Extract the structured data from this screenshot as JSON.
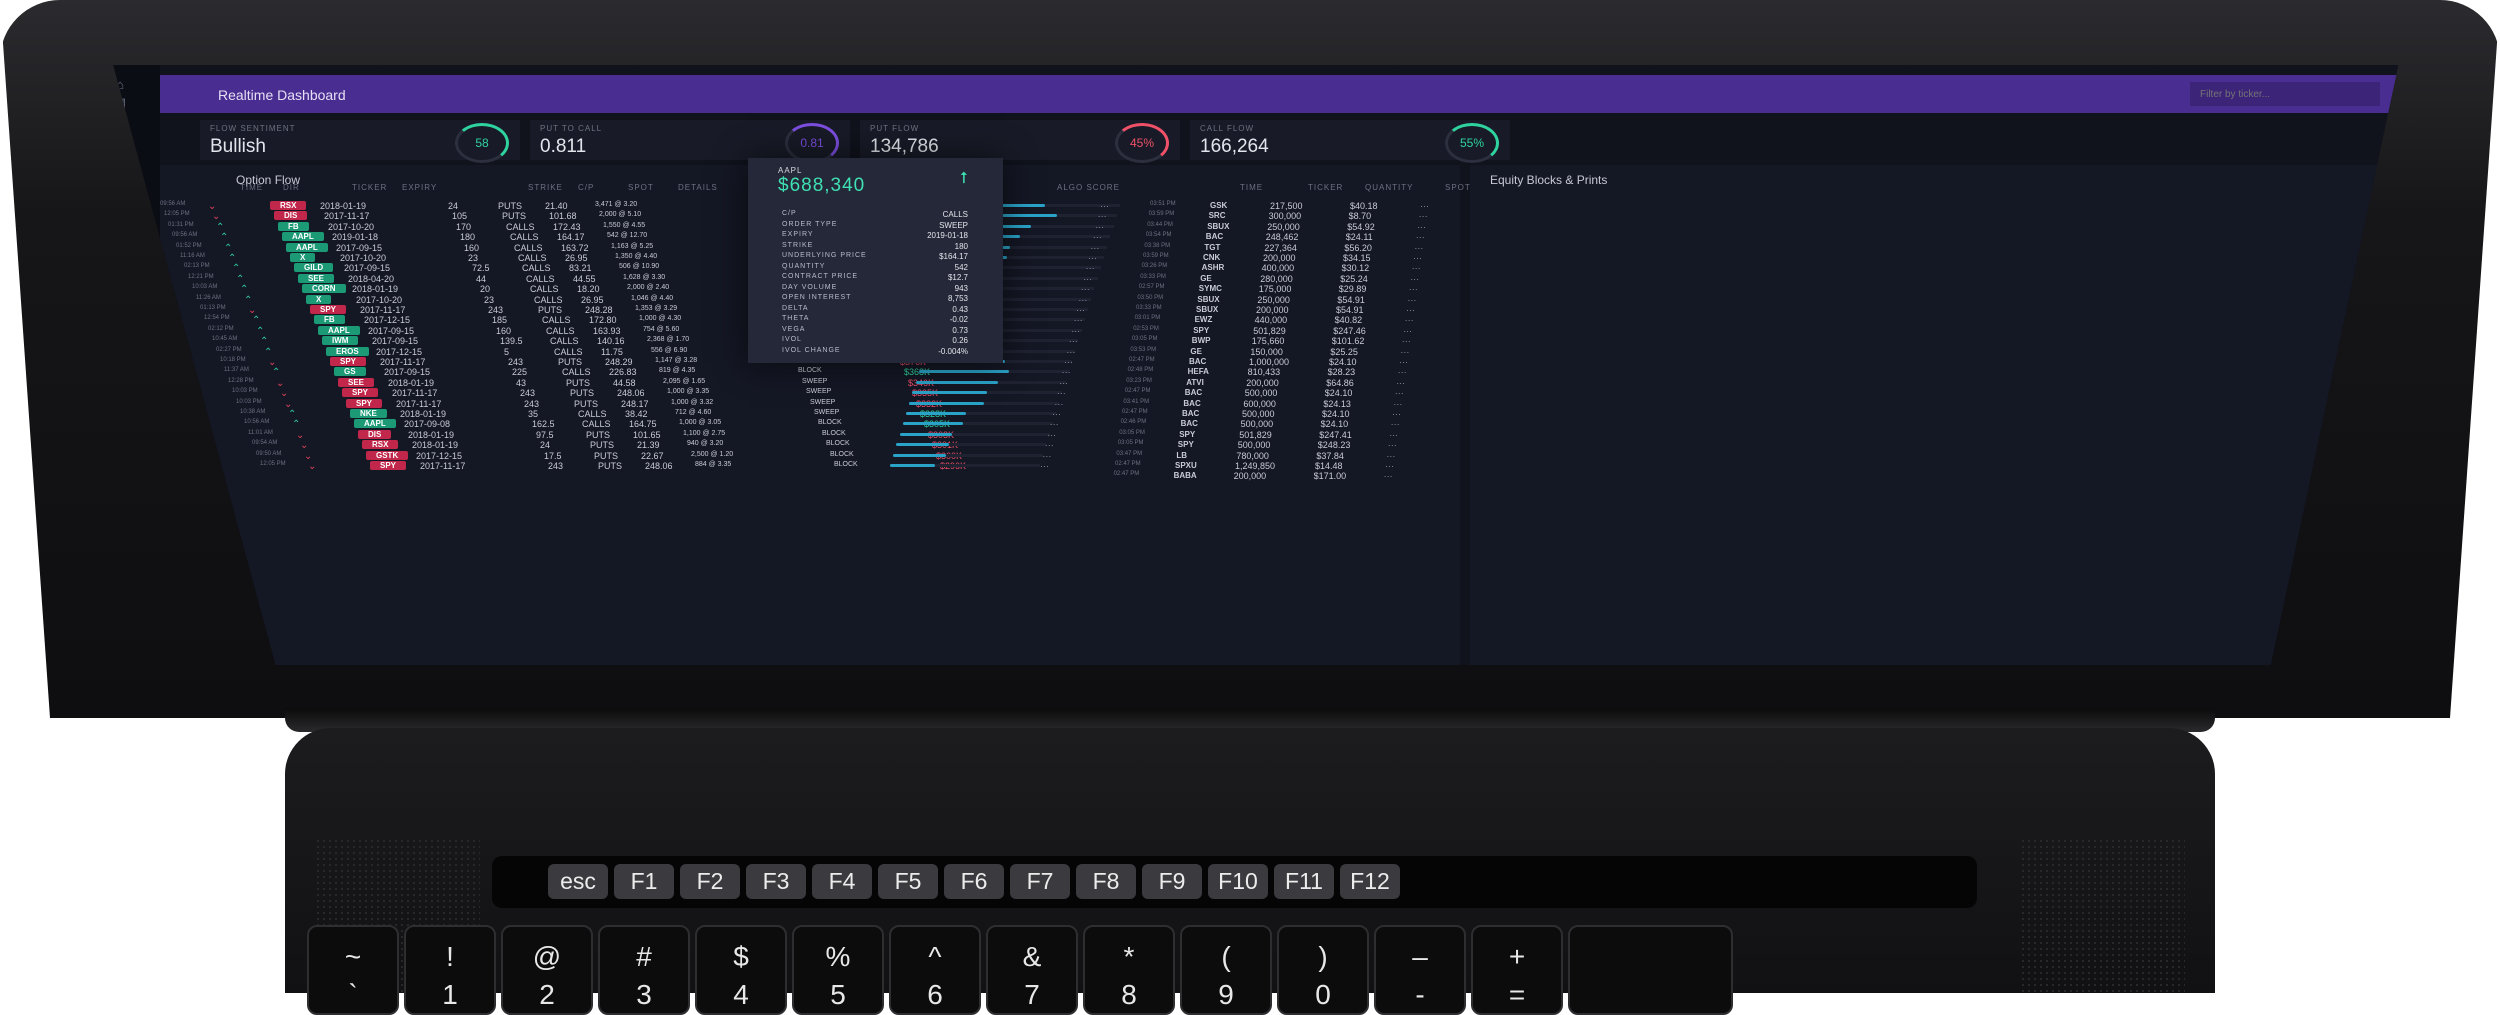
{
  "app": {
    "title": "Realtime Dashboard",
    "filter_placeholder": "Filter by ticker..."
  },
  "stats": [
    {
      "label": "Flow Sentiment",
      "value": "Bullish",
      "gauge": "58",
      "color": "#2fd39f"
    },
    {
      "label": "Put to Call",
      "value": "0.811",
      "gauge": "0.81",
      "color": "#7c4ee0"
    },
    {
      "label": "Put Flow",
      "value": "134,786",
      "gauge": "45%",
      "color": "#ef5169"
    },
    {
      "label": "Call Flow",
      "value": "166,264",
      "gauge": "55%",
      "color": "#2fd39f"
    }
  ],
  "option_flow": {
    "title": "Option Flow",
    "headers": {
      "time": "TIME",
      "dir": "DIR",
      "ticker": "TICKER",
      "expiry": "EXPIRY",
      "strike": "STRIKE",
      "cp": "C/P",
      "spot": "SPOT",
      "details": "DETAILS",
      "algo": "ALGO SCORE"
    },
    "rows": [
      {
        "time": "09:56 AM",
        "dir": "down",
        "ticker": "RSX",
        "tcolor": "red",
        "expiry": "2018-01-19",
        "strike": "24",
        "cp": "PUTS",
        "spot": "21.40",
        "details": "3,471 @ 3.20",
        "type": "",
        "premium": "",
        "pcolor": "green",
        "algo": 0.5
      },
      {
        "time": "12:05 PM",
        "dir": "down",
        "ticker": "DIS",
        "tcolor": "red",
        "expiry": "2017-11-17",
        "strike": "105",
        "cp": "PUTS",
        "spot": "101.68",
        "details": "2,000 @ 5.10",
        "type": "",
        "premium": "",
        "pcolor": "green",
        "algo": 0.6
      },
      {
        "time": "01:31 PM",
        "dir": "up",
        "ticker": "FB",
        "tcolor": "green",
        "expiry": "2017-10-20",
        "strike": "170",
        "cp": "CALLS",
        "spot": "172.43",
        "details": "1,550 @ 4.55",
        "type": "",
        "premium": "",
        "pcolor": "green",
        "algo": 0.45
      },
      {
        "time": "09:56 AM",
        "dir": "up",
        "ticker": "AAPL",
        "tcolor": "green",
        "expiry": "2019-01-18",
        "strike": "180",
        "cp": "CALLS",
        "spot": "164.17",
        "details": "542 @ 12.70",
        "type": "",
        "premium": "",
        "pcolor": "green",
        "algo": 0.4
      },
      {
        "time": "01:52 PM",
        "dir": "up",
        "ticker": "AAPL",
        "tcolor": "green",
        "expiry": "2017-09-15",
        "strike": "160",
        "cp": "CALLS",
        "spot": "163.72",
        "details": "1,163 @ 5.25",
        "type": "",
        "premium": "",
        "pcolor": "green",
        "algo": 0.35
      },
      {
        "time": "11:16 AM",
        "dir": "up",
        "ticker": "X",
        "tcolor": "green",
        "expiry": "2017-10-20",
        "strike": "23",
        "cp": "CALLS",
        "spot": "26.95",
        "details": "1,350 @ 4.40",
        "type": "",
        "premium": "",
        "pcolor": "green",
        "algo": 0.35
      },
      {
        "time": "02:13 PM",
        "dir": "up",
        "ticker": "GILD",
        "tcolor": "green",
        "expiry": "2017-09-15",
        "strike": "72.5",
        "cp": "CALLS",
        "spot": "83.21",
        "details": "506 @ 10.90",
        "type": "",
        "premium": "",
        "pcolor": "green",
        "algo": 0.3
      },
      {
        "time": "12:21 PM",
        "dir": "up",
        "ticker": "SEE",
        "tcolor": "green",
        "expiry": "2018-04-20",
        "strike": "44",
        "cp": "CALLS",
        "spot": "44.55",
        "details": "1,628 @ 3.30",
        "type": "",
        "premium": "",
        "pcolor": "green",
        "algo": 0.3
      },
      {
        "time": "10:03 AM",
        "dir": "up",
        "ticker": "CORN",
        "tcolor": "green",
        "expiry": "2018-01-19",
        "strike": "20",
        "cp": "CALLS",
        "spot": "18.20",
        "details": "2,000 @ 2.40",
        "type": "",
        "premium": "",
        "pcolor": "green",
        "algo": 0.25
      },
      {
        "time": "11:26 AM",
        "dir": "up",
        "ticker": "X",
        "tcolor": "green",
        "expiry": "2017-10-20",
        "strike": "23",
        "cp": "CALLS",
        "spot": "26.95",
        "details": "1,046 @ 4.40",
        "type": "",
        "premium": "",
        "pcolor": "green",
        "algo": 0.25
      },
      {
        "time": "01:13 PM",
        "dir": "down",
        "ticker": "SPY",
        "tcolor": "red",
        "expiry": "2017-11-17",
        "strike": "243",
        "cp": "PUTS",
        "spot": "248.28",
        "details": "1,353 @ 3.29",
        "type": "",
        "premium": "",
        "pcolor": "green",
        "algo": 0.2
      },
      {
        "time": "12:54 PM",
        "dir": "up",
        "ticker": "FB",
        "tcolor": "green",
        "expiry": "2017-12-15",
        "strike": "185",
        "cp": "CALLS",
        "spot": "172.80",
        "details": "1,000 @ 4.30",
        "type": "",
        "premium": "",
        "pcolor": "green",
        "algo": 0.25
      },
      {
        "time": "02:12 PM",
        "dir": "up",
        "ticker": "AAPL",
        "tcolor": "green",
        "expiry": "2017-09-15",
        "strike": "160",
        "cp": "CALLS",
        "spot": "163.93",
        "details": "754 @ 5.60",
        "type": "",
        "premium": "",
        "pcolor": "green",
        "algo": 0.3
      },
      {
        "time": "10:45 AM",
        "dir": "up",
        "ticker": "IWM",
        "tcolor": "green",
        "expiry": "2017-09-15",
        "strike": "139.5",
        "cp": "CALLS",
        "spot": "140.16",
        "details": "2,368 @ 1.70",
        "type": "",
        "premium": "",
        "pcolor": "green",
        "algo": 0.4
      },
      {
        "time": "02:27 PM",
        "dir": "up",
        "ticker": "EROS",
        "tcolor": "green",
        "expiry": "2017-12-15",
        "strike": "5",
        "cp": "CALLS",
        "spot": "11.75",
        "details": "556 @ 6.90",
        "type": "SWEEP",
        "premium": "$384K",
        "pcolor": "green",
        "algo": 0.45
      },
      {
        "time": "10:18 PM",
        "dir": "down",
        "ticker": "SPY",
        "tcolor": "red",
        "expiry": "2017-11-17",
        "strike": "243",
        "cp": "PUTS",
        "spot": "248.29",
        "details": "1,147 @ 3.28",
        "type": "SWEEP",
        "premium": "$376K",
        "pcolor": "red",
        "algo": 0.55
      },
      {
        "time": "11:37 AM",
        "dir": "up",
        "ticker": "GS",
        "tcolor": "green",
        "expiry": "2017-09-15",
        "strike": "225",
        "cp": "CALLS",
        "spot": "226.83",
        "details": "819 @ 4.35",
        "type": "BLOCK",
        "premium": "$368K",
        "pcolor": "green",
        "algo": 0.6
      },
      {
        "time": "12:28 PM",
        "dir": "down",
        "ticker": "SEE",
        "tcolor": "red",
        "expiry": "2018-01-19",
        "strike": "43",
        "cp": "PUTS",
        "spot": "44.58",
        "details": "2,095 @ 1.65",
        "type": "SWEEP",
        "premium": "$346K",
        "pcolor": "red",
        "algo": 0.55
      },
      {
        "time": "10:03 PM",
        "dir": "down",
        "ticker": "SPY",
        "tcolor": "red",
        "expiry": "2017-11-17",
        "strike": "243",
        "cp": "PUTS",
        "spot": "248.06",
        "details": "1,000 @ 3.35",
        "type": "SWEEP",
        "premium": "$335K",
        "pcolor": "red",
        "algo": 0.5
      },
      {
        "time": "10:03 PM",
        "dir": "down",
        "ticker": "SPY",
        "tcolor": "red",
        "expiry": "2017-11-17",
        "strike": "243",
        "cp": "PUTS",
        "spot": "248.17",
        "details": "1,000 @ 3.32",
        "type": "SWEEP",
        "premium": "$332K",
        "pcolor": "red",
        "algo": 0.5
      },
      {
        "time": "10:38 AM",
        "dir": "up",
        "ticker": "NKE",
        "tcolor": "green",
        "expiry": "2018-01-19",
        "strike": "35",
        "cp": "CALLS",
        "spot": "38.42",
        "details": "712 @ 4.60",
        "type": "SWEEP",
        "premium": "$328K",
        "pcolor": "green",
        "algo": 0.4
      },
      {
        "time": "10:56 AM",
        "dir": "up",
        "ticker": "AAPL",
        "tcolor": "green",
        "expiry": "2017-09-08",
        "strike": "162.5",
        "cp": "CALLS",
        "spot": "164.75",
        "details": "1,000 @ 3.05",
        "type": "BLOCK",
        "premium": "$305K",
        "pcolor": "green",
        "algo": 0.4
      },
      {
        "time": "11:01 AM",
        "dir": "down",
        "ticker": "DIS",
        "tcolor": "red",
        "expiry": "2018-01-19",
        "strike": "97.5",
        "cp": "PUTS",
        "spot": "101.65",
        "details": "1,100 @ 2.75",
        "type": "BLOCK",
        "premium": "$303K",
        "pcolor": "red",
        "algo": 0.35
      },
      {
        "time": "09:54 AM",
        "dir": "down",
        "ticker": "RSX",
        "tcolor": "red",
        "expiry": "2018-01-19",
        "strike": "24",
        "cp": "PUTS",
        "spot": "21.39",
        "details": "940 @ 3.20",
        "type": "BLOCK",
        "premium": "$301K",
        "pcolor": "red",
        "algo": 0.35
      },
      {
        "time": "09:50 AM",
        "dir": "down",
        "ticker": "GSTK",
        "tcolor": "red",
        "expiry": "2017-12-15",
        "strike": "17.5",
        "cp": "PUTS",
        "spot": "22.67",
        "details": "2,500 @ 1.20",
        "type": "BLOCK",
        "premium": "$300K",
        "pcolor": "red",
        "algo": 0.35
      },
      {
        "time": "12:05 PM",
        "dir": "down",
        "ticker": "SPY",
        "tcolor": "red",
        "expiry": "2017-11-17",
        "strike": "243",
        "cp": "PUTS",
        "spot": "248.06",
        "details": "884 @ 3.35",
        "type": "BLOCK",
        "premium": "$296K",
        "pcolor": "red",
        "algo": 0.3
      }
    ]
  },
  "detail": {
    "ticker": "AAPL",
    "value": "$688,340",
    "rows": [
      {
        "label": "C/P",
        "value": "CALLS"
      },
      {
        "label": "ORDER TYPE",
        "value": "SWEEP"
      },
      {
        "label": "EXPIRY",
        "value": "2019-01-18"
      },
      {
        "label": "STRIKE",
        "value": "180"
      },
      {
        "label": "UNDERLYING PRICE",
        "value": "$164.17"
      },
      {
        "label": "QUANTITY",
        "value": "542"
      },
      {
        "label": "CONTRACT PRICE",
        "value": "$12.7"
      },
      {
        "label": "DAY VOLUME",
        "value": "943"
      },
      {
        "label": "OPEN INTEREST",
        "value": "8,753"
      },
      {
        "label": "DELTA",
        "value": "0.43"
      },
      {
        "label": "THETA",
        "value": "-0.02"
      },
      {
        "label": "VEGA",
        "value": "0.73"
      },
      {
        "label": "IVOL",
        "value": "0.26"
      },
      {
        "label": "IVOL CHANGE",
        "value": "-0.004%"
      }
    ]
  },
  "equity": {
    "title": "Equity Blocks & Prints",
    "headers": {
      "time": "TIME",
      "ticker": "TICKER",
      "quantity": "QUANTITY",
      "spot": "SPOT"
    },
    "rows": [
      {
        "time": "03:51 PM",
        "ticker": "GSK",
        "qty": "217,500",
        "spot": "$40.18"
      },
      {
        "time": "03:59 PM",
        "ticker": "SRC",
        "qty": "300,000",
        "spot": "$8.70"
      },
      {
        "time": "03:44 PM",
        "ticker": "SBUX",
        "qty": "250,000",
        "spot": "$54.92"
      },
      {
        "time": "03:54 PM",
        "ticker": "BAC",
        "qty": "248,462",
        "spot": "$24.11"
      },
      {
        "time": "03:38 PM",
        "ticker": "TGT",
        "qty": "227,364",
        "spot": "$56.20"
      },
      {
        "time": "03:59 PM",
        "ticker": "CNK",
        "qty": "200,000",
        "spot": "$34.15"
      },
      {
        "time": "03:26 PM",
        "ticker": "ASHR",
        "qty": "400,000",
        "spot": "$30.12"
      },
      {
        "time": "03:33 PM",
        "ticker": "GE",
        "qty": "280,000",
        "spot": "$25.24"
      },
      {
        "time": "02:57 PM",
        "ticker": "SYMC",
        "qty": "175,000",
        "spot": "$29.89"
      },
      {
        "time": "03:50 PM",
        "ticker": "SBUX",
        "qty": "250,000",
        "spot": "$54.91"
      },
      {
        "time": "03:33 PM",
        "ticker": "SBUX",
        "qty": "200,000",
        "spot": "$54.91"
      },
      {
        "time": "03:01 PM",
        "ticker": "EWZ",
        "qty": "440,000",
        "spot": "$40.82"
      },
      {
        "time": "02:53 PM",
        "ticker": "SPY",
        "qty": "501,829",
        "spot": "$247.46"
      },
      {
        "time": "03:05 PM",
        "ticker": "BWP",
        "qty": "175,660",
        "spot": "$101.62"
      },
      {
        "time": "03:53 PM",
        "ticker": "GE",
        "qty": "150,000",
        "spot": "$25.25"
      },
      {
        "time": "02:47 PM",
        "ticker": "BAC",
        "qty": "1,000,000",
        "spot": "$24.10"
      },
      {
        "time": "02:48 PM",
        "ticker": "HEFA",
        "qty": "810,433",
        "spot": "$28.23"
      },
      {
        "time": "03:23 PM",
        "ticker": "ATVI",
        "qty": "200,000",
        "spot": "$64.86"
      },
      {
        "time": "02:47 PM",
        "ticker": "BAC",
        "qty": "500,000",
        "spot": "$24.10"
      },
      {
        "time": "03:41 PM",
        "ticker": "BAC",
        "qty": "600,000",
        "spot": "$24.13"
      },
      {
        "time": "02:47 PM",
        "ticker": "BAC",
        "qty": "500,000",
        "spot": "$24.10"
      },
      {
        "time": "02:46 PM",
        "ticker": "BAC",
        "qty": "500,000",
        "spot": "$24.10"
      },
      {
        "time": "03:05 PM",
        "ticker": "SPY",
        "qty": "501,829",
        "spot": "$247.41"
      },
      {
        "time": "03:05 PM",
        "ticker": "SPY",
        "qty": "500,000",
        "spot": "$248.23"
      },
      {
        "time": "03:47 PM",
        "ticker": "LB",
        "qty": "780,000",
        "spot": "$37.84"
      },
      {
        "time": "02:47 PM",
        "ticker": "SPXU",
        "qty": "1,249,850",
        "spot": "$14.48"
      },
      {
        "time": "02:47 PM",
        "ticker": "BABA",
        "qty": "200,000",
        "spot": "$171.00"
      }
    ]
  },
  "touchbar": [
    "esc",
    "F1",
    "F2",
    "F3",
    "F4",
    "F5",
    "F6",
    "F7",
    "F8",
    "F9",
    "F10",
    "F11",
    "F12"
  ],
  "keys": [
    {
      "top": "~",
      "bot": "`"
    },
    {
      "top": "!",
      "bot": "1"
    },
    {
      "top": "@",
      "bot": "2"
    },
    {
      "top": "#",
      "bot": "3"
    },
    {
      "top": "$",
      "bot": "4"
    },
    {
      "top": "%",
      "bot": "5"
    },
    {
      "top": "^",
      "bot": "6"
    },
    {
      "top": "&",
      "bot": "7"
    },
    {
      "top": "*",
      "bot": "8"
    },
    {
      "top": "(",
      "bot": "9"
    },
    {
      "top": ")",
      "bot": "0"
    },
    {
      "top": "–",
      "bot": "-"
    },
    {
      "top": "+",
      "bot": "="
    },
    {
      "top": "",
      "bot": ""
    }
  ],
  "rail_icons": [
    "home-icon",
    "grid-icon",
    "alert-icon",
    "clock-icon",
    "list-icon",
    "chart-icon",
    "settings-icon",
    "info-icon"
  ]
}
